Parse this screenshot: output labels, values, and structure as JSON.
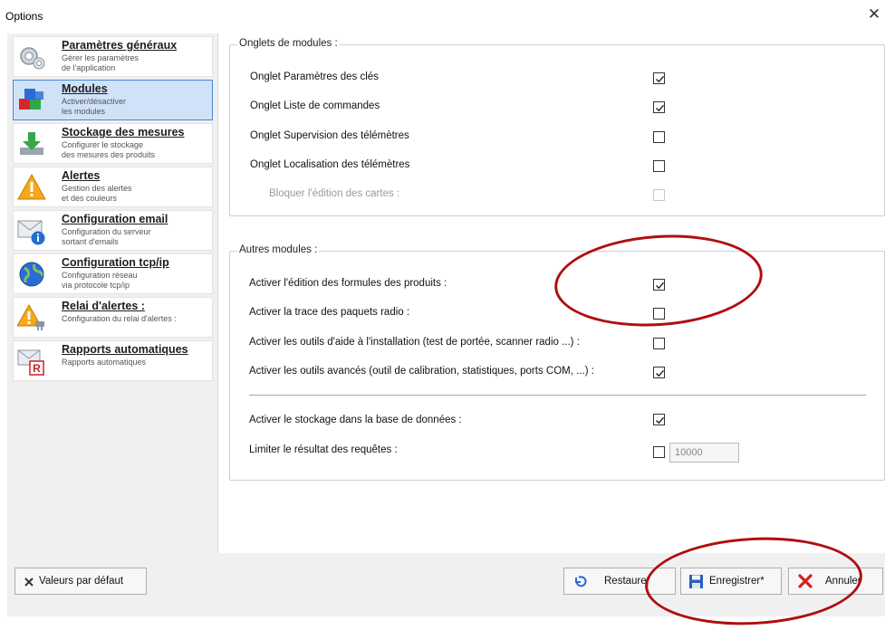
{
  "window": {
    "title": "Options"
  },
  "sidebar": {
    "items": [
      {
        "title": "Paramètres généraux",
        "desc": "Gérer les paramètres\nde l'application",
        "icon": "gear-icon"
      },
      {
        "title": "Modules",
        "desc": "Activer/désactiver\nles modules",
        "icon": "modules-cubes-icon"
      },
      {
        "title": "Stockage des mesures",
        "desc": "Configurer le stockage\ndes mesures des produits",
        "icon": "download-icon"
      },
      {
        "title": "Alertes",
        "desc": "Gestion des alertes\net des couleurs",
        "icon": "warning-icon"
      },
      {
        "title": "Configuration email",
        "desc": "Configuration du serveur\nsortant d'emails",
        "icon": "email-info-icon"
      },
      {
        "title": "Configuration tcp/ip",
        "desc": "Configuration réseau\nvia protocole tcp/ip",
        "icon": "globe-icon"
      },
      {
        "title": "Relai d'alertes :",
        "desc": "Configuration du relai d'alertes :",
        "icon": "alert-relay-icon"
      },
      {
        "title": "Rapports automatiques",
        "desc": "Rapports automatiques",
        "icon": "report-icon"
      }
    ]
  },
  "groups": {
    "onglets": {
      "title": "Onglets de modules :",
      "rows": [
        {
          "label": "Onglet Paramètres des clés",
          "checked": true,
          "disabled": false
        },
        {
          "label": "Onglet Liste de commandes",
          "checked": true,
          "disabled": false
        },
        {
          "label": "Onglet Supervision des télémètres",
          "checked": false,
          "disabled": false
        },
        {
          "label": "Onglet Localisation des télémètres",
          "checked": false,
          "disabled": false
        },
        {
          "label": "Bloquer l'édition des cartes :",
          "checked": false,
          "disabled": true
        }
      ]
    },
    "autres": {
      "title": "Autres modules :",
      "rows": [
        {
          "label": "Activer l'édition des formules des produits :",
          "checked": true,
          "disabled": false
        },
        {
          "label": "Activer la trace des paquets radio :",
          "checked": false,
          "disabled": false
        },
        {
          "label": "Activer les outils d'aide à l'installation (test de portée, scanner radio ...) :",
          "checked": false,
          "disabled": false
        },
        {
          "label": "Activer les outils avancés (outil de calibration, statistiques, ports COM, ...) :",
          "checked": true,
          "disabled": false
        },
        {
          "label": "Activer le stockage dans la base de données :",
          "checked": true,
          "disabled": false
        },
        {
          "label": "Limiter le résultat des requêtes :",
          "checked": false,
          "disabled": false
        }
      ],
      "limit_value": "10000"
    }
  },
  "footer": {
    "defaults_label": "Valeurs par défaut",
    "restore_label": "Restaurer",
    "save_label": "Enregistrer*",
    "cancel_label": "Annuler"
  },
  "colors": {
    "annotation": "#b00e0e",
    "selected": "#cfe2f8",
    "accent": "#4b87d6"
  }
}
